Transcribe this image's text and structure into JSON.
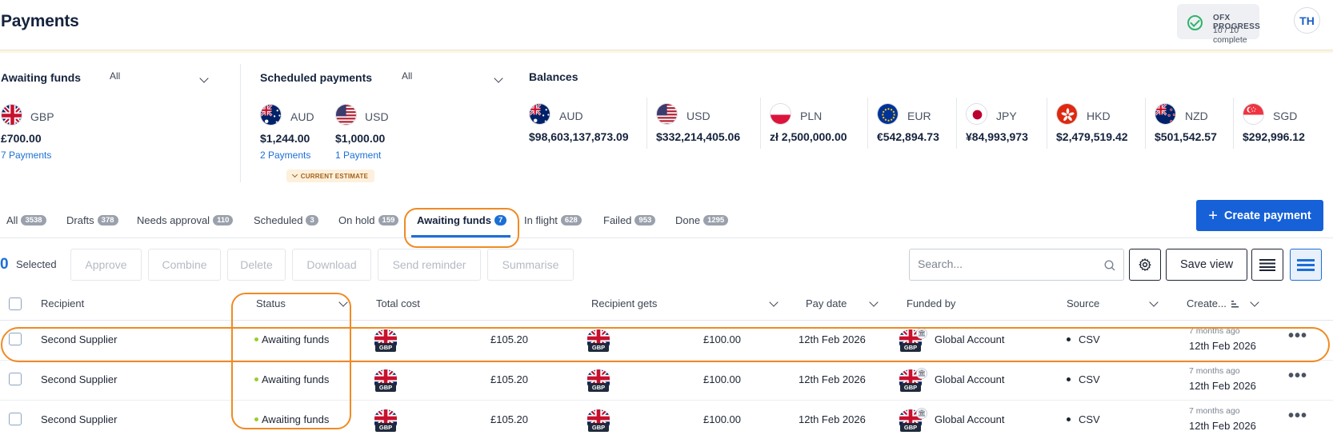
{
  "header": {
    "title": "Payments",
    "progress_title": "OFX PROGRESS",
    "progress_sub": "10 / 10 complete",
    "avatar_initials": "TH"
  },
  "awaiting": {
    "label": "Awaiting funds",
    "filter": "All",
    "currency": "GBP",
    "amount": "£700.00",
    "link": "7 Payments"
  },
  "scheduled": {
    "label": "Scheduled payments",
    "filter": "All",
    "items": [
      {
        "currency": "AUD",
        "amount": "$1,244.00",
        "link": "2 Payments"
      },
      {
        "currency": "USD",
        "amount": "$1,000.00",
        "link": "1 Payment"
      }
    ],
    "estimate": "CURRENT ESTIMATE"
  },
  "balances": {
    "label": "Balances",
    "items": [
      {
        "currency": "AUD",
        "amount": "$98,603,137,873.09"
      },
      {
        "currency": "USD",
        "amount": "$332,214,405.06"
      },
      {
        "currency": "PLN",
        "amount": "zł 2,500,000.00"
      },
      {
        "currency": "EUR",
        "amount": "€542,894.73"
      },
      {
        "currency": "JPY",
        "amount": "¥84,993,973"
      },
      {
        "currency": "HKD",
        "amount": "$2,479,519.42"
      },
      {
        "currency": "NZD",
        "amount": "$501,542.57"
      },
      {
        "currency": "SGD",
        "amount": "$292,996.12"
      }
    ]
  },
  "tabs": [
    {
      "label": "All",
      "count": "3538"
    },
    {
      "label": "Drafts",
      "count": "378"
    },
    {
      "label": "Needs approval",
      "count": "110"
    },
    {
      "label": "Scheduled",
      "count": "3"
    },
    {
      "label": "On hold",
      "count": "159"
    },
    {
      "label": "Awaiting funds",
      "count": "7"
    },
    {
      "label": "In flight",
      "count": "628"
    },
    {
      "label": "Failed",
      "count": "953"
    },
    {
      "label": "Done",
      "count": "1295"
    }
  ],
  "create_button": "Create payment",
  "toolbar": {
    "selected_count": "0",
    "selected_label": "Selected",
    "approve": "Approve",
    "combine": "Combine",
    "delete": "Delete",
    "download": "Download",
    "send_reminder": "Send reminder",
    "summarise": "Summarise",
    "search_placeholder": "Search...",
    "save_view": "Save view"
  },
  "table": {
    "headers": {
      "recipient": "Recipient",
      "status": "Status",
      "total_cost": "Total cost",
      "recipient_gets": "Recipient gets",
      "pay_date": "Pay date",
      "funded_by": "Funded by",
      "source": "Source",
      "created": "Create..."
    },
    "rows": [
      {
        "recipient": "Second Supplier",
        "status": "Awaiting funds",
        "cost_currency": "GBP",
        "total_cost": "£105.20",
        "gets_currency": "GBP",
        "recipient_gets": "£100.00",
        "pay_date": "12th Feb 2026",
        "funded_currency": "GBP",
        "funded_by": "Global Account",
        "source": "CSV",
        "ago": "7 months ago",
        "created": "12th Feb 2026"
      },
      {
        "recipient": "Second Supplier",
        "status": "Awaiting funds",
        "cost_currency": "GBP",
        "total_cost": "£105.20",
        "gets_currency": "GBP",
        "recipient_gets": "£100.00",
        "pay_date": "12th Feb 2026",
        "funded_currency": "GBP",
        "funded_by": "Global Account",
        "source": "CSV",
        "ago": "7 months ago",
        "created": "12th Feb 2026"
      },
      {
        "recipient": "Second Supplier",
        "status": "Awaiting funds",
        "cost_currency": "GBP",
        "total_cost": "£105.20",
        "gets_currency": "GBP",
        "recipient_gets": "£100.00",
        "pay_date": "12th Feb 2026",
        "funded_currency": "GBP",
        "funded_by": "Global Account",
        "source": "CSV",
        "ago": "7 months ago",
        "created": "12th Feb 2026"
      }
    ]
  },
  "colors": {
    "accent": "#1661d8",
    "highlight": "#f08a24",
    "status_dot": "#9acd32"
  }
}
